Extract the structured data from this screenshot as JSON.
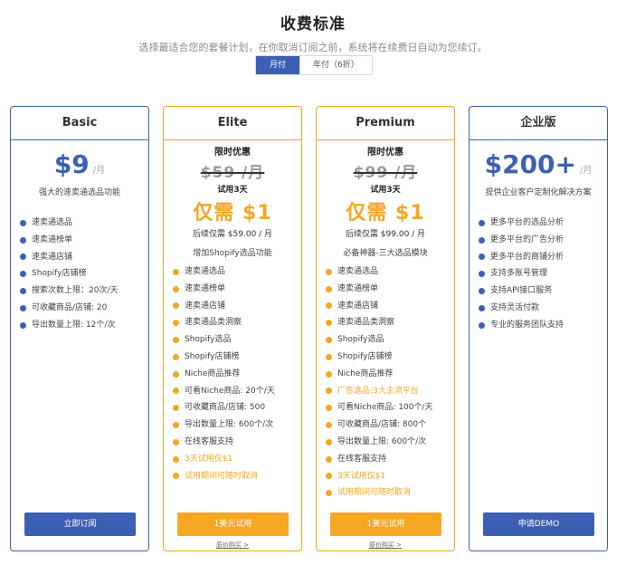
{
  "header": {
    "title": "收费标准",
    "subtitle": "选择最适合您的套餐计划，在你取消订阅之前，系统将在续费日自动为您续订。",
    "billing_options": [
      "月付",
      "年付（6折）"
    ]
  },
  "plans": [
    {
      "name": "Basic",
      "price": "$9",
      "unit": "/月",
      "description": "强大的速卖通选品功能",
      "features": [
        {
          "text": "速卖通选品",
          "highlight": false
        },
        {
          "text": "速卖通榜单",
          "highlight": false
        },
        {
          "text": "速卖通店铺",
          "highlight": false
        },
        {
          "text": "Shopify店铺榜",
          "highlight": false
        },
        {
          "text": "搜索次数上限：20次/天",
          "highlight": false
        },
        {
          "text": "可收藏商品/店铺: 20",
          "highlight": false
        },
        {
          "text": "导出数量上限: 12个/次",
          "highlight": false
        }
      ],
      "cta": "立即订阅"
    },
    {
      "name": "Elite",
      "promo_label": "限时优惠",
      "original_price": "$59 /月",
      "trial_label": "试用3天",
      "promo_price": "仅需 $1",
      "renew_price": "后续仅需 $59.00 / 月",
      "description": "增加Shopify选品功能",
      "features": [
        {
          "text": "速卖通选品",
          "highlight": false
        },
        {
          "text": "速卖通榜单",
          "highlight": false
        },
        {
          "text": "速卖通店铺",
          "highlight": false
        },
        {
          "text": "速卖通品类洞察",
          "highlight": false
        },
        {
          "text": "Shopify选品",
          "highlight": false
        },
        {
          "text": "Shopify店铺榜",
          "highlight": false
        },
        {
          "text": "Niche商品推荐",
          "highlight": false
        },
        {
          "text": "可看Niche商品: 20个/天",
          "highlight": false
        },
        {
          "text": "可收藏商品/店铺: 500",
          "highlight": false
        },
        {
          "text": "导出数量上限: 600个/次",
          "highlight": false
        },
        {
          "text": "在线客服支持",
          "highlight": false
        },
        {
          "text": "3天试用仅$1",
          "highlight": true
        },
        {
          "text": "试用期间可随时取消",
          "highlight": true
        }
      ],
      "cta": "1美元试用",
      "orig_link": "原价购买 >"
    },
    {
      "name": "Premium",
      "promo_label": "限时优惠",
      "original_price": "$99 /月",
      "trial_label": "试用3天",
      "promo_price": "仅需 $1",
      "renew_price": "后续仅需 $99.00 / 月",
      "description": "必备神器-三大选品模块",
      "features": [
        {
          "text": "速卖通选品",
          "highlight": false
        },
        {
          "text": "速卖通榜单",
          "highlight": false
        },
        {
          "text": "速卖通店铺",
          "highlight": false
        },
        {
          "text": "速卖通品类洞察",
          "highlight": false
        },
        {
          "text": "Shopify选品",
          "highlight": false
        },
        {
          "text": "Shopify店铺榜",
          "highlight": false
        },
        {
          "text": "Niche商品推荐",
          "highlight": false
        },
        {
          "text": "广告选品:3大主流平台",
          "highlight": true
        },
        {
          "text": "可看Niche商品: 100个/天",
          "highlight": false
        },
        {
          "text": "可收藏商品/店铺: 800个",
          "highlight": false
        },
        {
          "text": "导出数量上限: 600个/次",
          "highlight": false
        },
        {
          "text": "在线客服支持",
          "highlight": false
        },
        {
          "text": "3天试用仅$1",
          "highlight": true
        },
        {
          "text": "试用期间可随时取消",
          "highlight": true
        }
      ],
      "cta": "1美元试用",
      "orig_link": "原价购买 >"
    },
    {
      "name": "企业版",
      "price": "$200+",
      "unit": "/月",
      "description": "提供企业客户定制化解决方案",
      "features": [
        {
          "text": "更多平台的选品分析",
          "highlight": false
        },
        {
          "text": "更多平台的广告分析",
          "highlight": false
        },
        {
          "text": "更多平台的商铺分析",
          "highlight": false
        },
        {
          "text": "支持多账号管理",
          "highlight": false
        },
        {
          "text": "支持API接口服务",
          "highlight": false
        },
        {
          "text": "支持灵活付款",
          "highlight": false
        },
        {
          "text": "专业的服务团队支持",
          "highlight": false
        }
      ],
      "cta": "申请DEMO"
    }
  ],
  "colors": {
    "brand_blue": "#3d5fb3",
    "accent_orange": "#f5a623"
  }
}
